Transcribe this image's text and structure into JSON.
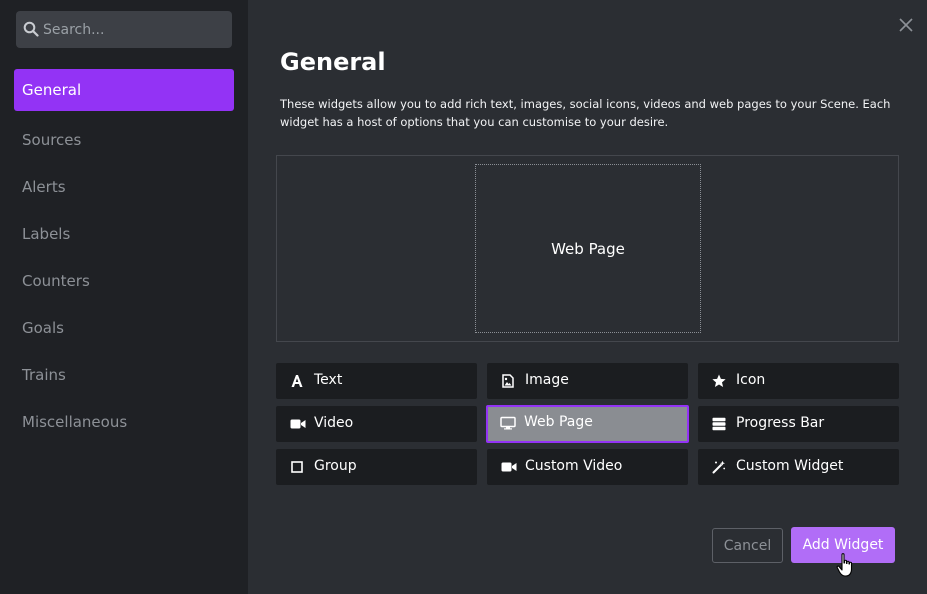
{
  "search": {
    "placeholder": "Search...",
    "icon": "search-icon"
  },
  "sidebar": {
    "items": [
      {
        "label": "General",
        "active": true
      },
      {
        "label": "Sources"
      },
      {
        "label": "Alerts"
      },
      {
        "label": "Labels"
      },
      {
        "label": "Counters"
      },
      {
        "label": "Goals"
      },
      {
        "label": "Trains"
      },
      {
        "label": "Miscellaneous"
      }
    ]
  },
  "main": {
    "title": "General",
    "description": "These widgets allow you to add rich text, images, social icons, videos and web pages to your Scene. Each widget has a host of options that you can customise to your desire.",
    "preview_label": "Web Page"
  },
  "widgets": [
    {
      "label": "Text",
      "icon": "text-icon"
    },
    {
      "label": "Image",
      "icon": "image-icon"
    },
    {
      "label": "Icon",
      "icon": "star-icon"
    },
    {
      "label": "Video",
      "icon": "video-icon"
    },
    {
      "label": "Web Page",
      "icon": "monitor-icon",
      "selected": true
    },
    {
      "label": "Progress Bar",
      "icon": "progress-bar-icon"
    },
    {
      "label": "Group",
      "icon": "square-icon"
    },
    {
      "label": "Custom Video",
      "icon": "video-icon"
    },
    {
      "label": "Custom Widget",
      "icon": "magic-wand-icon"
    }
  ],
  "buttons": {
    "cancel": "Cancel",
    "add": "Add Widget"
  },
  "colors": {
    "accent": "#9333f5",
    "add_button": "#b16df7",
    "sidebar_bg": "#1f2125",
    "main_bg": "#2b2e33",
    "tile_bg": "#1b1d20",
    "selected_tile_bg": "#8a8d92"
  }
}
